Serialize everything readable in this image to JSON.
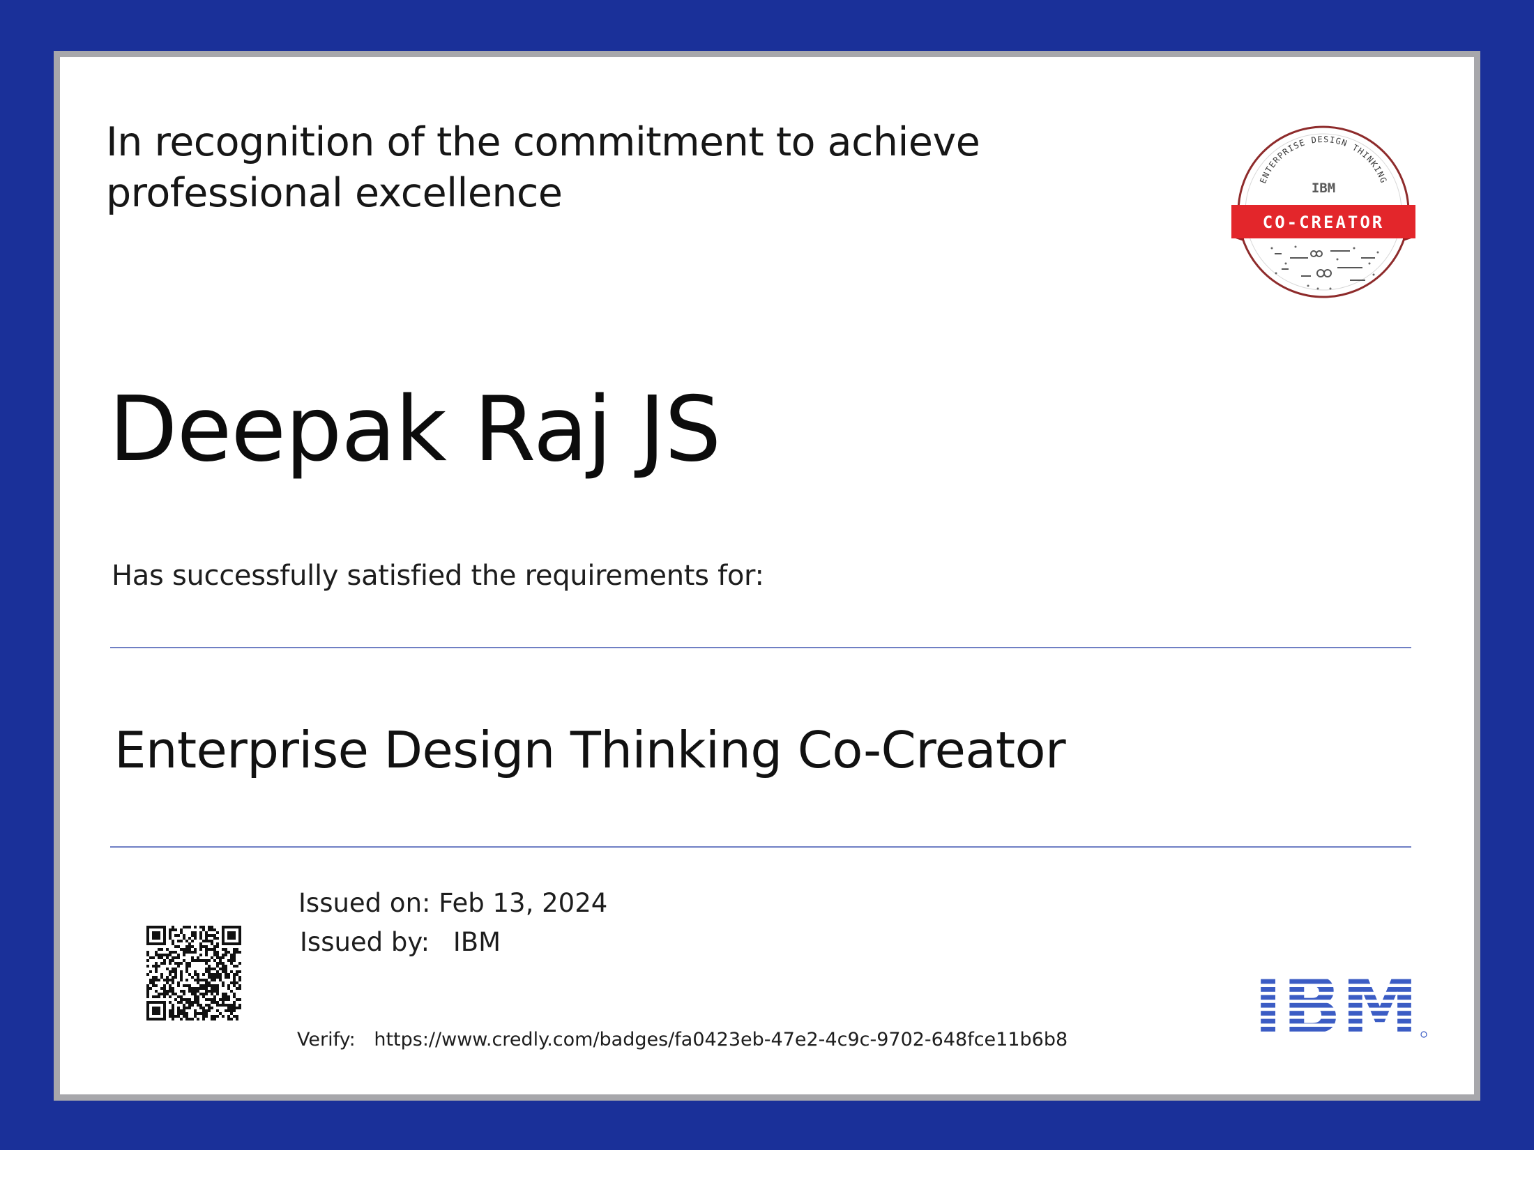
{
  "certificate": {
    "recognition_line": "In recognition of the commitment to achieve professional excellence",
    "recipient_name": "Deepak Raj JS",
    "satisfied_label": "Has successfully satisfied the requirements for:",
    "credential_title": "Enterprise Design Thinking Co-Creator",
    "issued_on_label": "Issued on:",
    "issued_on_value": "Feb 13, 2024",
    "issued_by_label": "Issued by:",
    "issued_by_value": "IBM",
    "verify_label": "Verify:",
    "verify_url": "https://www.credly.com/badges/fa0423eb-47e2-4c9c-9702-648fce11b6b8"
  },
  "badge": {
    "arc_text": "ENTERPRISE DESIGN THINKING",
    "brand": "IBM",
    "ribbon_text": "CO-CREATOR",
    "ribbon_color": "#e3262b",
    "ring_color": "#8e2b2b"
  },
  "logo": {
    "text": "IBM",
    "color": "#3b5cc4",
    "icon": "ibm-striped-logo-icon"
  },
  "colors": {
    "frame": "#1a3099",
    "rule": "#6f7fc4"
  },
  "qr": {
    "icon": "qr-code-icon"
  }
}
